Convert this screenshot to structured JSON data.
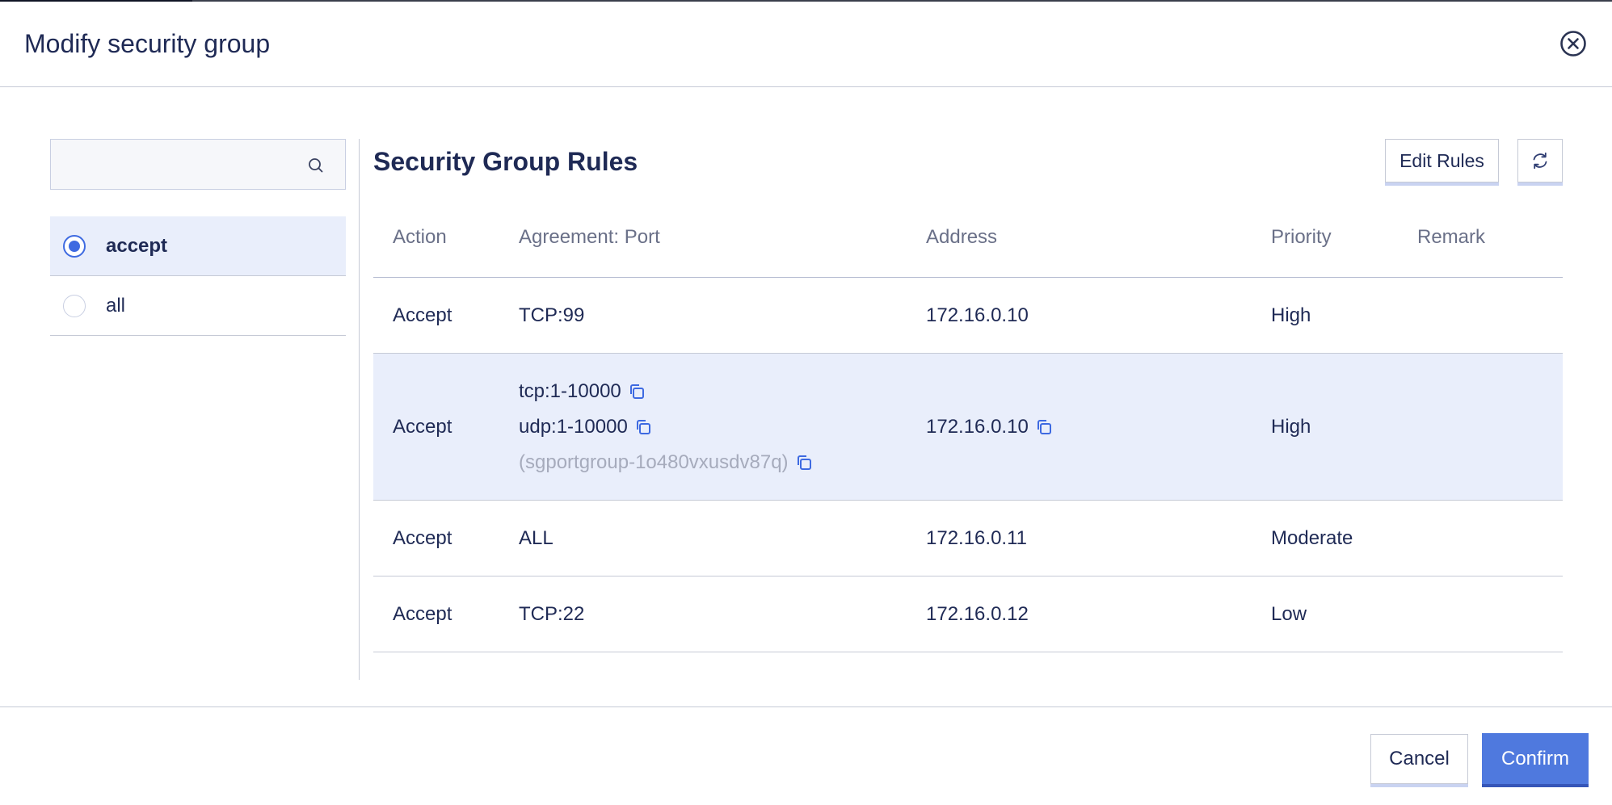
{
  "modal": {
    "title": "Modify security group",
    "close_icon": "close-circle-icon"
  },
  "search": {
    "value": "",
    "placeholder": "",
    "icon": "search-icon"
  },
  "groups": [
    {
      "label": "accept",
      "selected": true
    },
    {
      "label": "all",
      "selected": false
    }
  ],
  "rules_panel": {
    "title": "Security Group Rules",
    "edit_label": "Edit Rules",
    "refresh_icon": "refresh-icon"
  },
  "table": {
    "headers": {
      "action": "Action",
      "port": "Agreement: Port",
      "address": "Address",
      "priority": "Priority",
      "remark": "Remark"
    },
    "rows": [
      {
        "action": "Accept",
        "port": "TCP:99",
        "address": "172.16.0.10",
        "priority": "High",
        "remark": ""
      },
      {
        "action": "Accept",
        "ports": [
          "tcp:1-10000",
          "udp:1-10000"
        ],
        "port_group": "(sgportgroup-1o480vxusdv87q)",
        "address": "172.16.0.10",
        "priority": "High",
        "remark": ""
      },
      {
        "action": "Accept",
        "port": "ALL",
        "address": "172.16.0.11",
        "priority": "Moderate",
        "remark": ""
      },
      {
        "action": "Accept",
        "port": "TCP:22",
        "address": "172.16.0.12",
        "priority": "Low",
        "remark": ""
      }
    ]
  },
  "footer": {
    "cancel_label": "Cancel",
    "confirm_label": "Confirm"
  },
  "colors": {
    "accent": "#3e6ae1",
    "confirm_bg": "#4f79de",
    "selected_bg": "#e9eefb",
    "text": "#1f2a55",
    "muted_text": "#a6abbc"
  }
}
